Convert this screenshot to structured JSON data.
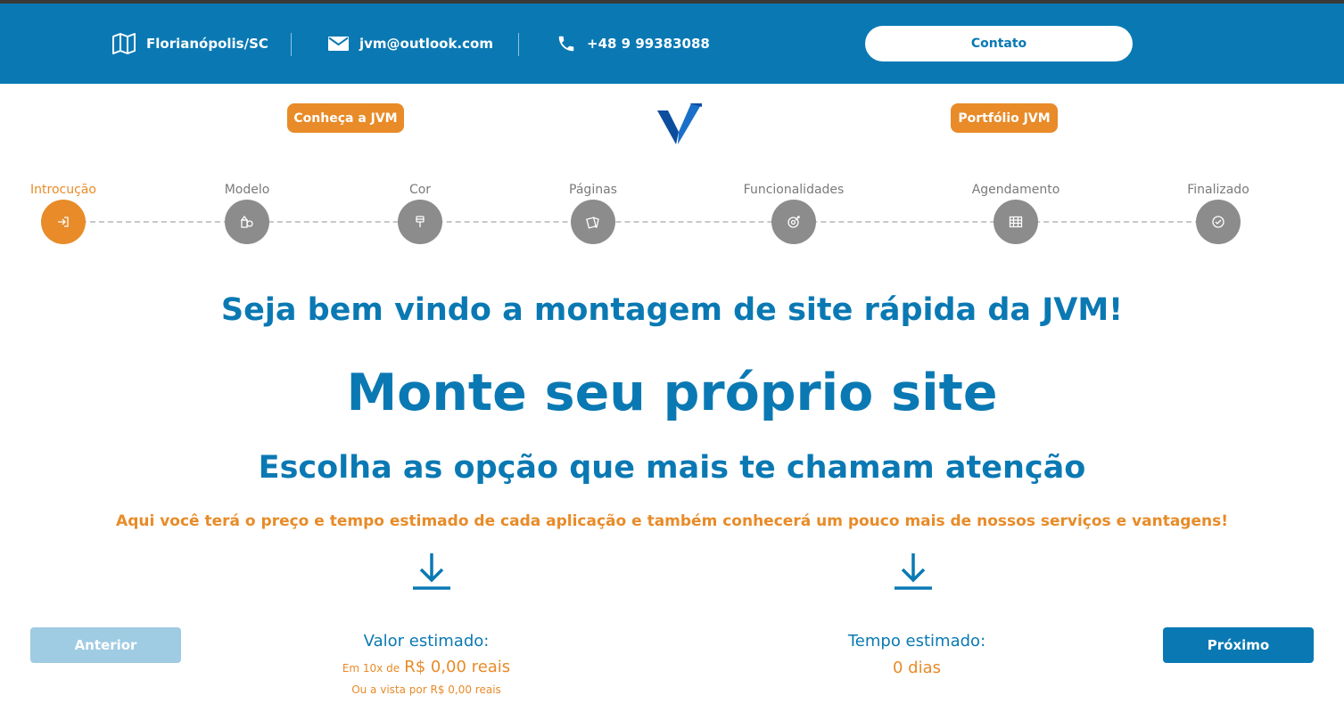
{
  "topbar": {
    "location": "Florianópolis/SC",
    "email": "jvm@outlook.com",
    "phone": "+48 9 99383088",
    "contact_button": "Contato"
  },
  "nav": {
    "about_button": "Conheça a JVM",
    "portfolio_button": "Portfólio JVM"
  },
  "steps": [
    {
      "label": "Introcução",
      "icon": "login-icon",
      "active": true
    },
    {
      "label": "Modelo",
      "icon": "shapes-icon",
      "active": false
    },
    {
      "label": "Cor",
      "icon": "paint-brush-icon",
      "active": false
    },
    {
      "label": "Páginas",
      "icon": "pages-icon",
      "active": false
    },
    {
      "label": "Funcionalidades",
      "icon": "target-icon",
      "active": false
    },
    {
      "label": "Agendamento",
      "icon": "calendar-icon",
      "active": false
    },
    {
      "label": "Finalizado",
      "icon": "check-circle-icon",
      "active": false
    }
  ],
  "main": {
    "welcome": "Seja bem vindo a montagem de site rápida da JVM!",
    "headline": "Monte seu próprio site",
    "subheadline": "Escolha as opção que mais te chamam atenção",
    "description": "Aqui você terá o preço e tempo estimado de cada aplicação e também conhecerá um pouco mais de nossos serviços e vantagens!"
  },
  "footer": {
    "prev_button": "Anterior",
    "next_button": "Próximo",
    "value_label": "Valor estimado:",
    "installment_prefix": "Em 10x de",
    "installment_value": "R$ 0,00 reais",
    "cash_value": "Ou a vista por R$ 0,00 reais",
    "time_label": "Tempo estimado:",
    "time_value": "0 dias"
  },
  "colors": {
    "brand_blue": "#0a79b3",
    "accent_orange": "#e88b28",
    "inactive_gray": "#8c8c8c",
    "disabled_blue": "#9fcbe3"
  }
}
